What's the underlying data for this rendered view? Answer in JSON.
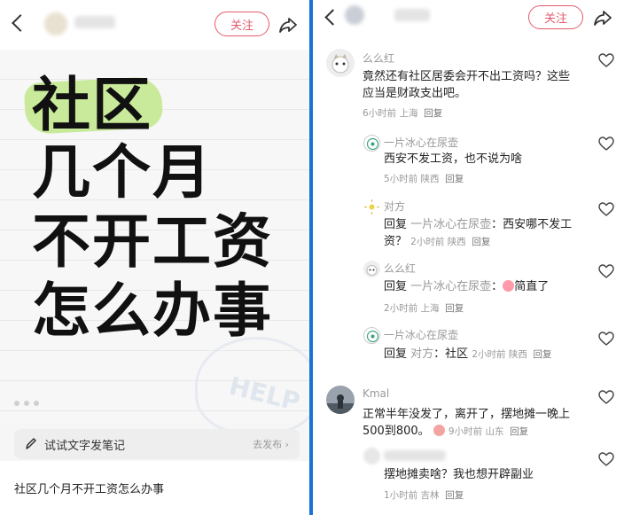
{
  "left": {
    "follow_label": "关注",
    "poster_lines": [
      "社区",
      "几个月",
      "不开工资",
      "怎么办事"
    ],
    "help_text": "HELP",
    "note_placeholder": "试试文字发笔记",
    "note_action": "去发布 ›",
    "caption": "社区几个月不开工资怎么办事"
  },
  "right": {
    "follow_label": "关注",
    "comments": [
      {
        "user": "么么红",
        "text": "竟然还有社区居委会开不出工资吗？这些应当是财政支出吧。",
        "time": "6小时前",
        "location": "上海",
        "reply": "回复"
      },
      {
        "user": "一片冰心在尿壶",
        "text": "西安不发工资，也不说为啥",
        "time": "5小时前",
        "location": "陕西",
        "reply": "回复"
      },
      {
        "user": "对方",
        "prefix": "回复",
        "quoted_user": "一片冰心在尿壶",
        "text": "：西安哪不发工资？",
        "time": "2小时前",
        "location": "陕西",
        "reply": "回复"
      },
      {
        "user": "么么红",
        "prefix": "回复",
        "quoted_user": "一片冰心在尿壶",
        "text": "简直了",
        "time": "2小时前",
        "location": "上海",
        "reply": "回复"
      },
      {
        "user": "一片冰心在尿壶",
        "prefix": "回复",
        "quoted_user": "对方",
        "text": "：社区",
        "time": "2小时前",
        "location": "陕西",
        "reply": "回复"
      },
      {
        "user": "Kmal",
        "text": "正常半年没发了，离开了，摆地摊一晚上500到800。",
        "time": "9小时前",
        "location": "山东",
        "reply": "回复"
      },
      {
        "user": "",
        "text": "摆地摊卖啥？我也想开辟副业",
        "time": "1小时前",
        "location": "吉林",
        "reply": "回复"
      }
    ]
  },
  "colors": {
    "accent": "#e45b6d",
    "highlight": "#bfe88a",
    "divider": "#1a72d4"
  }
}
